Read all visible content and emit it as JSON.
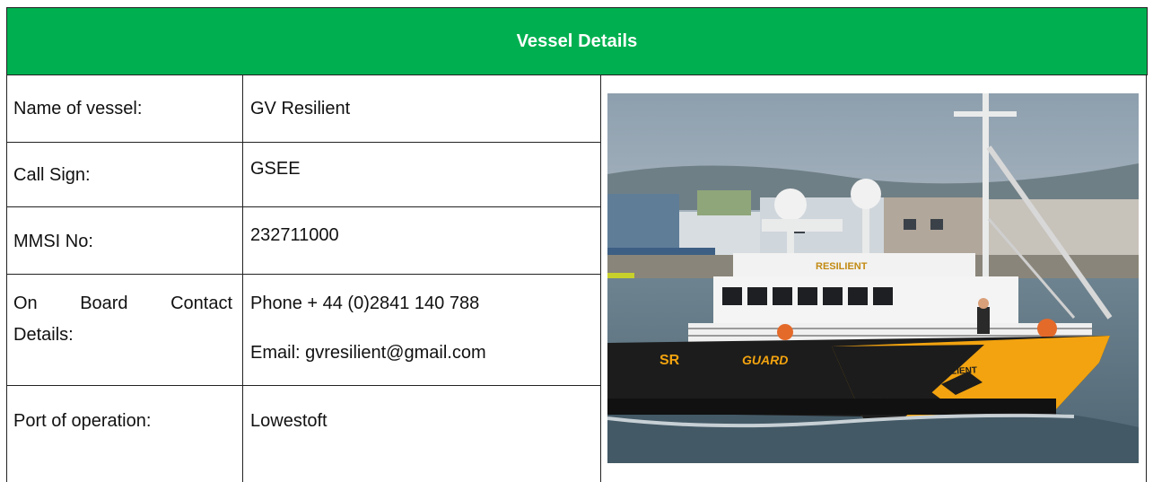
{
  "title": "Vessel Details",
  "rows": [
    {
      "label": "Name of vessel:",
      "value": "GV Resilient"
    },
    {
      "label": "Call Sign:",
      "value": "GSEE"
    },
    {
      "label": "MMSI No:",
      "value": "232711000"
    },
    {
      "label_line1": "On Board Contact",
      "label_line2": "Details:",
      "phone": "Phone + 44 (0)2841 140 788",
      "email": "Email: gvresilient@gmail.com"
    },
    {
      "label": "Port of operation:",
      "value": "Lowestoft"
    }
  ],
  "photo": {
    "hull_name_side": "GUARD",
    "hull_name_bow": "RESILIENT",
    "bridge_name": "RESILIENT",
    "hull_logo": "SR",
    "colors": {
      "hull": "#f2a30f",
      "dark_hull": "#1c1c1c",
      "superstructure": "#f4f4f4",
      "water": "#5d7584"
    }
  },
  "colors": {
    "header": "#00b050",
    "border": "#222222"
  }
}
